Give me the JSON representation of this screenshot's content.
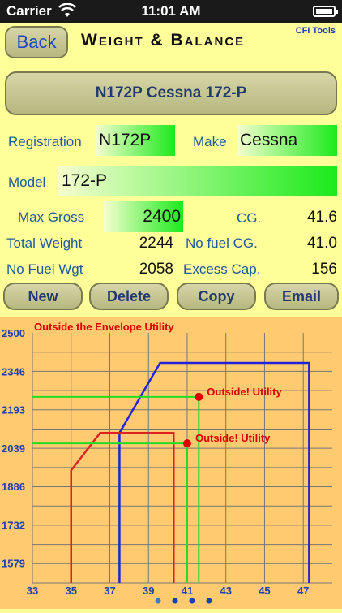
{
  "status_bar": {
    "carrier": "Carrier",
    "time": "11:01 AM"
  },
  "header": {
    "back_label": "Back",
    "title": "Weight & Balance",
    "brand": "CFI Tools"
  },
  "aircraft_button": {
    "label": "N172P Cessna 172-P"
  },
  "form": {
    "registration_label": "Registration",
    "registration_value": "N172P",
    "make_label": "Make",
    "make_value": "Cessna",
    "model_label": "Model",
    "model_value": "172-P",
    "max_gross_label": "Max Gross",
    "max_gross_value": "2400",
    "cg_label": "CG.",
    "cg_value": "41.6",
    "total_weight_label": "Total Weight",
    "total_weight_value": "2244",
    "no_fuel_cg_label": "No fuel CG.",
    "no_fuel_cg_value": "41.0",
    "no_fuel_wgt_label": "No Fuel Wgt",
    "no_fuel_wgt_value": "2058",
    "excess_cap_label": "Excess Cap.",
    "excess_cap_value": "156"
  },
  "actions": {
    "new": "New",
    "delete": "Delete",
    "copy": "Copy",
    "email": "Email"
  },
  "chart_data": {
    "type": "line",
    "title": "Outside the Envelope Utility",
    "x_ticks": [
      "33",
      "35",
      "37",
      "39",
      "41",
      "43",
      "45",
      "47"
    ],
    "y_ticks": [
      "2500",
      "2346",
      "2193",
      "2039",
      "1886",
      "1732",
      "1579"
    ],
    "xlim": [
      33,
      48.5
    ],
    "ylim": [
      1500,
      2500
    ],
    "series": [
      {
        "color": "#2222dd",
        "points": [
          [
            47.3,
            1500
          ],
          [
            47.3,
            2380
          ],
          [
            39.6,
            2380
          ],
          [
            37.5,
            2100
          ],
          [
            37.5,
            1500
          ]
        ]
      },
      {
        "color": "#dd2222",
        "points": [
          [
            35,
            1500
          ],
          [
            35,
            1950
          ],
          [
            36.5,
            2100
          ],
          [
            40.3,
            2100
          ],
          [
            40.3,
            1500
          ]
        ]
      }
    ],
    "markers": [
      {
        "x": 41.6,
        "y": 2244,
        "label": "Outside! Utility",
        "color": "#dd0000",
        "line_color": "#22dd22"
      },
      {
        "x": 41.0,
        "y": 2058,
        "label": "Outside! Utility",
        "color": "#dd0000",
        "line_color": "#22dd22"
      }
    ],
    "page_dots": 4,
    "page_dots_active": 0
  }
}
